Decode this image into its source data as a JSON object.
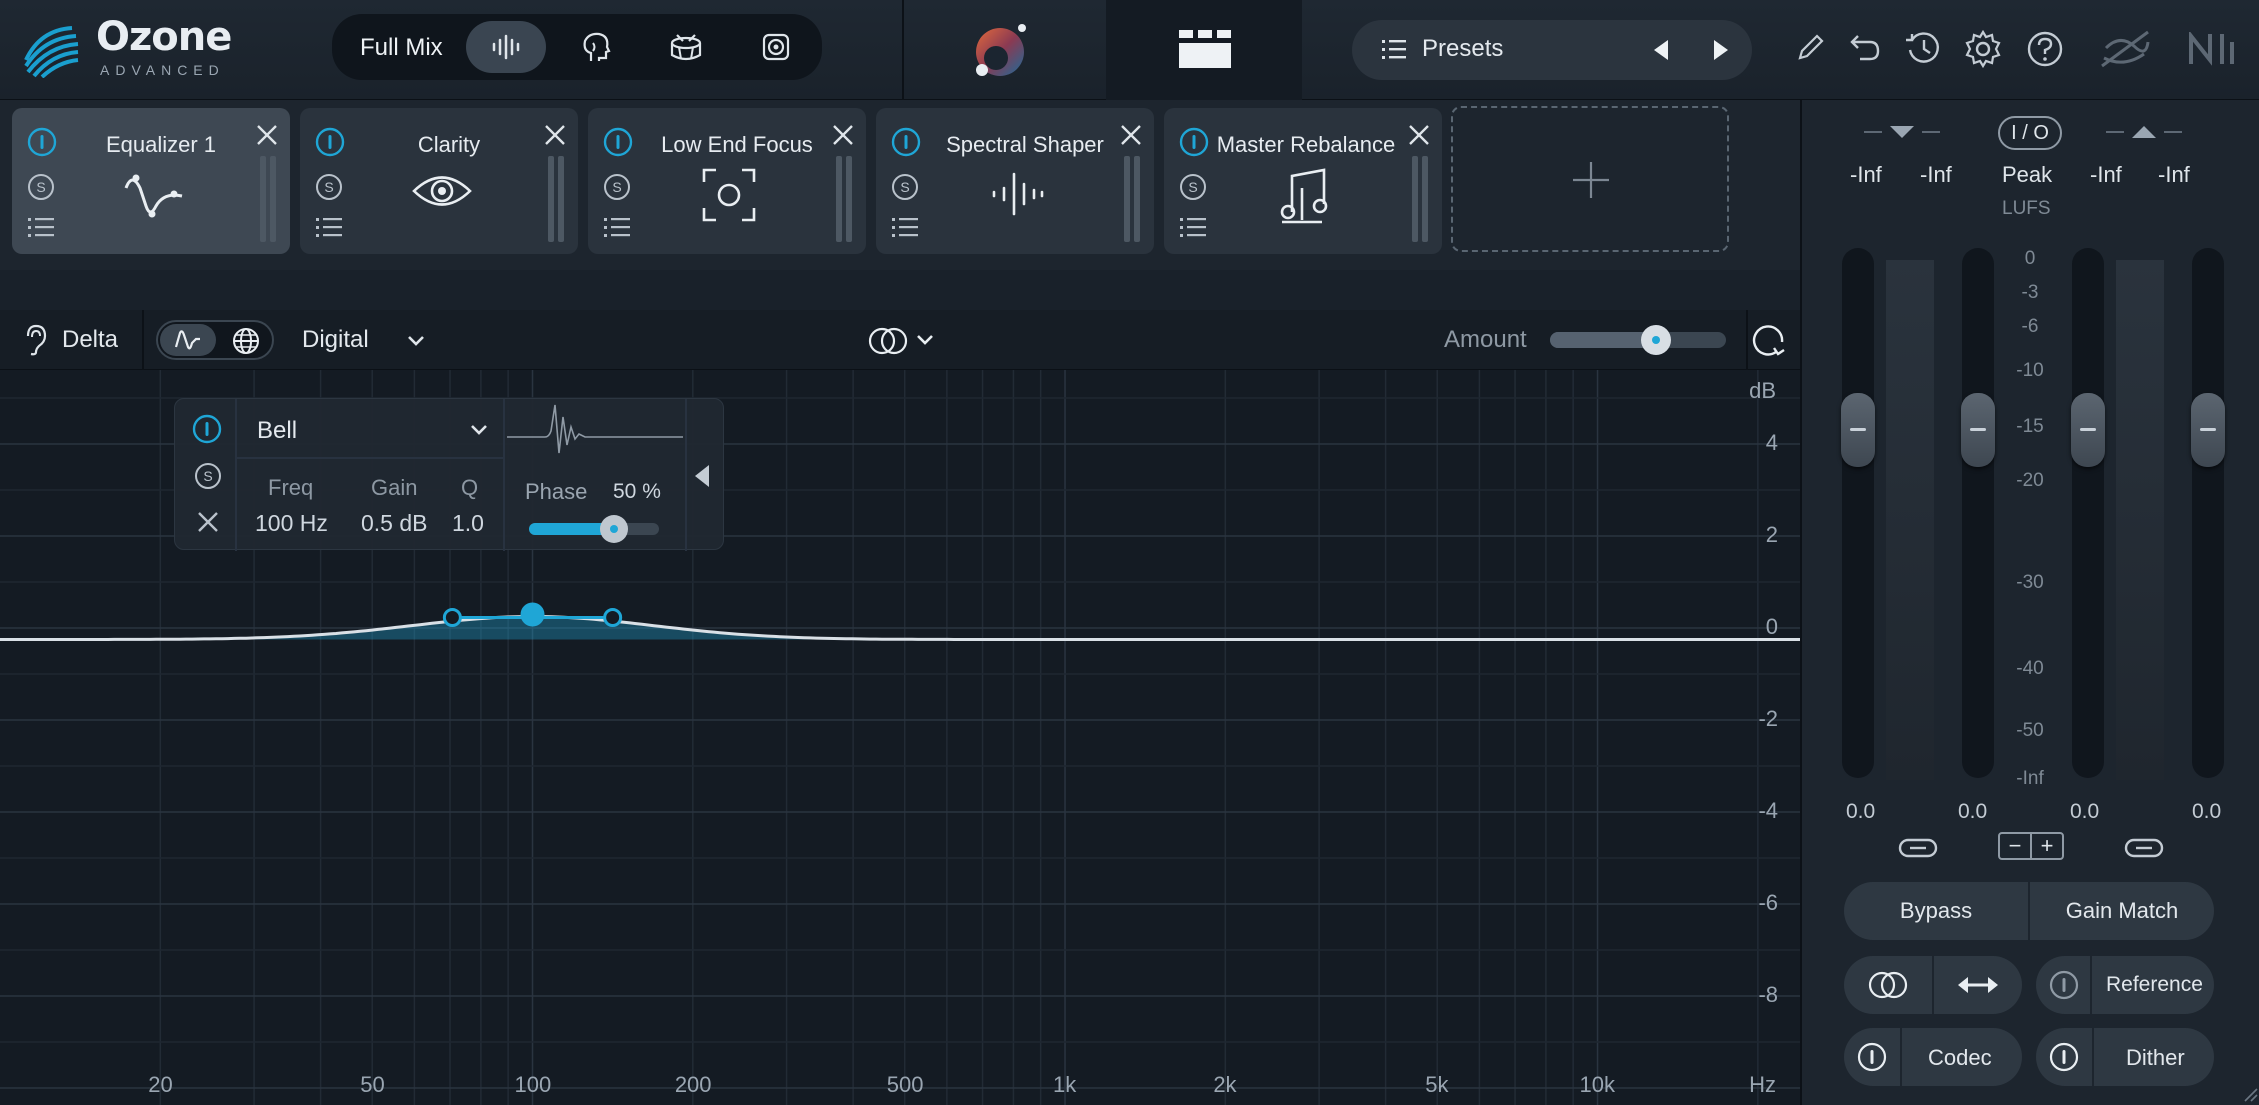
{
  "app": {
    "logo_name": "Ozone",
    "logo_edition": "ADVANCED"
  },
  "topbar": {
    "mode_label": "Full Mix",
    "presets_label": "Presets"
  },
  "modules": [
    {
      "name": "Equalizer 1",
      "active": true
    },
    {
      "name": "Clarity",
      "active": false
    },
    {
      "name": "Low End Focus",
      "active": false
    },
    {
      "name": "Spectral Shaper",
      "active": false
    },
    {
      "name": "Master Rebalance",
      "active": false
    }
  ],
  "eq_toolbar": {
    "delta_label": "Delta",
    "mode_select": "Digital",
    "amount_label": "Amount",
    "amount_value": 0.6
  },
  "band": {
    "type": "Bell",
    "freq_label": "Freq",
    "gain_label": "Gain",
    "q_label": "Q",
    "freq_value": "100 Hz",
    "gain_value": "0.5 dB",
    "q_value": "1.0",
    "phase_label": "Phase",
    "phase_value": "50 %",
    "phase_fraction": 0.5
  },
  "graph": {
    "db_unit": "dB",
    "db_ticks": [
      "4",
      "2",
      "0",
      "-2",
      "-4",
      "-6",
      "-8"
    ],
    "hz_unit": "Hz",
    "hz_ticks": [
      "20",
      "50",
      "100",
      "200",
      "500",
      "1k",
      "2k",
      "5k",
      "10k"
    ]
  },
  "meters": {
    "io_label": "I / O",
    "left_in": "-Inf",
    "right_in": "-Inf",
    "peak_label": "Peak",
    "lufs_label": "LUFS",
    "left_out": "-Inf",
    "right_out": "-Inf",
    "scale": [
      "0",
      "-3",
      "-6",
      "-10",
      "-15",
      "-20",
      "-30",
      "-40",
      "-50",
      "-Inf"
    ],
    "fader_values": [
      "0.0",
      "0.0",
      "0.0",
      "0.0"
    ]
  },
  "right_buttons": {
    "bypass": "Bypass",
    "gain_match": "Gain Match",
    "reference": "Reference",
    "codec": "Codec",
    "dither": "Dither"
  },
  "colors": {
    "accent": "#1fa6d6",
    "background": "#141b23",
    "panel": "#1d252e"
  }
}
